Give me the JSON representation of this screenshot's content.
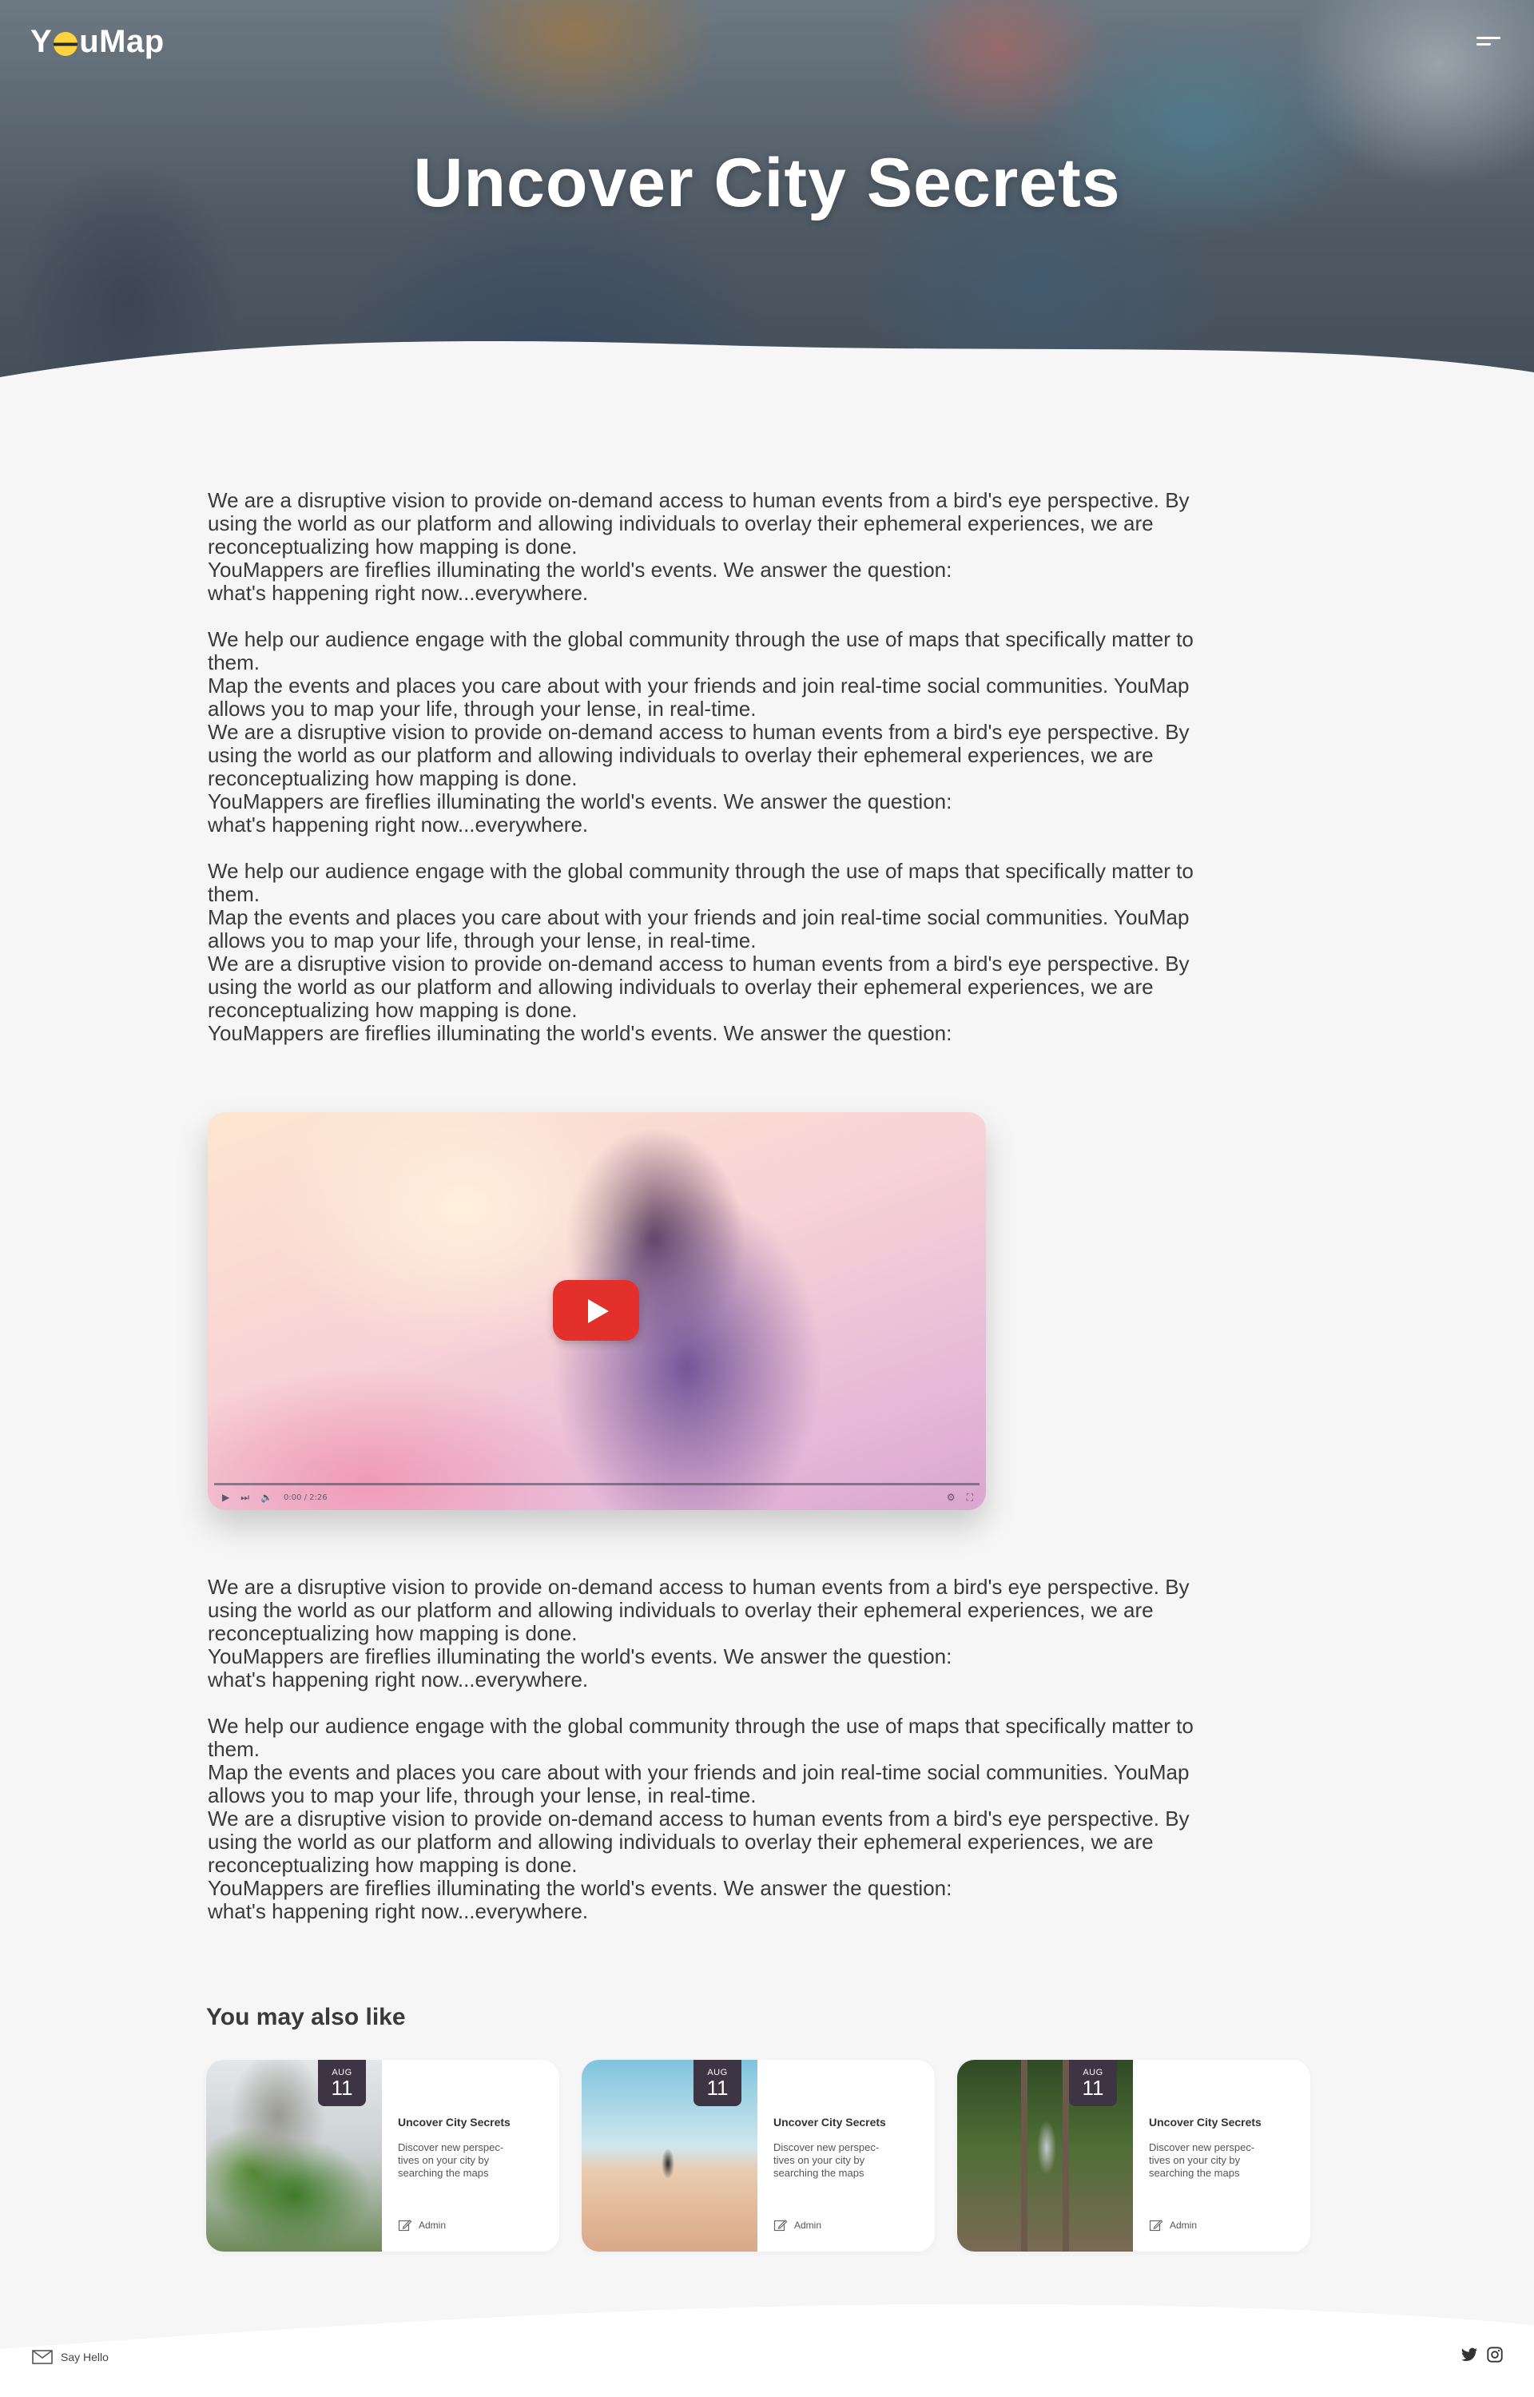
{
  "header": {
    "logo_text_start": "Y",
    "logo_text_end": "uMap",
    "title": "Uncover City Secrets"
  },
  "article": {
    "block1": "We are a disruptive vision to provide on-demand access to human events from a bird's eye perspective. By\nusing the world as our platform and allowing individuals to overlay their ephemeral experiences, we are\nreconceptualizing how mapping is done.\nYouMappers are fireflies illuminating the world's events. We answer the question:\nwhat's happening right now...everywhere.\n\nWe help our audience engage with the global community through the use of maps that specifically matter to\nthem.\nMap the events and places you care about with your friends and join real-time social communities. YouMap\nallows you to map your life, through your lense, in real-time.\nWe are a disruptive vision to provide on-demand access to human events from a bird's eye perspective. By\nusing the world as our platform and allowing individuals to overlay their ephemeral experiences, we are\nreconceptualizing how mapping is done.\nYouMappers are fireflies illuminating the world's events. We answer the question:\nwhat's happening right now...everywhere.\n\nWe help our audience engage with the global community through the use of maps that specifically matter to\nthem.\nMap the events and places you care about with your friends and join real-time social communities. YouMap\nallows you to map your life, through your lense, in real-time.\nWe are a disruptive vision to provide on-demand access to human events from a bird's eye perspective. By\nusing the world as our platform and allowing individuals to overlay their ephemeral experiences, we are\nreconceptualizing how mapping is done.\nYouMappers are fireflies illuminating the world's events. We answer the question:",
    "block2": "We are a disruptive vision to provide on-demand access to human events from a bird's eye perspective. By\nusing the world as our platform and allowing individuals to overlay their ephemeral experiences, we are\nreconceptualizing how mapping is done.\nYouMappers are fireflies illuminating the world's events. We answer the question:\nwhat's happening right now...everywhere.\n\nWe help our audience engage with the global community through the use of maps that specifically matter to\nthem.\nMap the events and places you care about with your friends and join real-time social communities. YouMap\nallows you to map your life, through your lense, in real-time.\nWe are a disruptive vision to provide on-demand access to human events from a bird's eye perspective. By\nusing the world as our platform and allowing individuals to overlay their ephemeral experiences, we are\nreconceptualizing how mapping is done.\nYouMappers are fireflies illuminating the world's events. We answer the question:\nwhat's happening right now...everywhere."
  },
  "video": {
    "time": "0:00 / 2:26",
    "controls": [
      "play-icon",
      "next-icon",
      "volume-icon",
      "settings-icon",
      "fullscreen-icon"
    ]
  },
  "related": {
    "title": "You may also like",
    "cards": [
      {
        "month": "AUG",
        "day": "11",
        "title": "Uncover City Secrets",
        "desc": "Discover new perspec-\ntives on your city by\nsearching the maps",
        "author": "Admin",
        "image": "cliff-forest"
      },
      {
        "month": "AUG",
        "day": "11",
        "title": "Uncover City Secrets",
        "desc": "Discover new perspec-\ntives on your city by\nsearching the maps",
        "author": "Admin",
        "image": "desert-walker"
      },
      {
        "month": "AUG",
        "day": "11",
        "title": "Uncover City Secrets",
        "desc": "Discover new perspec-\ntives on your city by\nsearching the maps",
        "author": "Admin",
        "image": "railway-forest"
      }
    ]
  },
  "footer": {
    "say_hello": "Say Hello",
    "icons": [
      "mail-icon",
      "twitter-icon",
      "instagram-icon"
    ]
  },
  "colors": {
    "page_background": "#f6f6f6",
    "text": "#3a3a3a",
    "date_badge": "#3d3543",
    "play_button": "#e3302a",
    "logo_accent": "#ffd23f"
  }
}
